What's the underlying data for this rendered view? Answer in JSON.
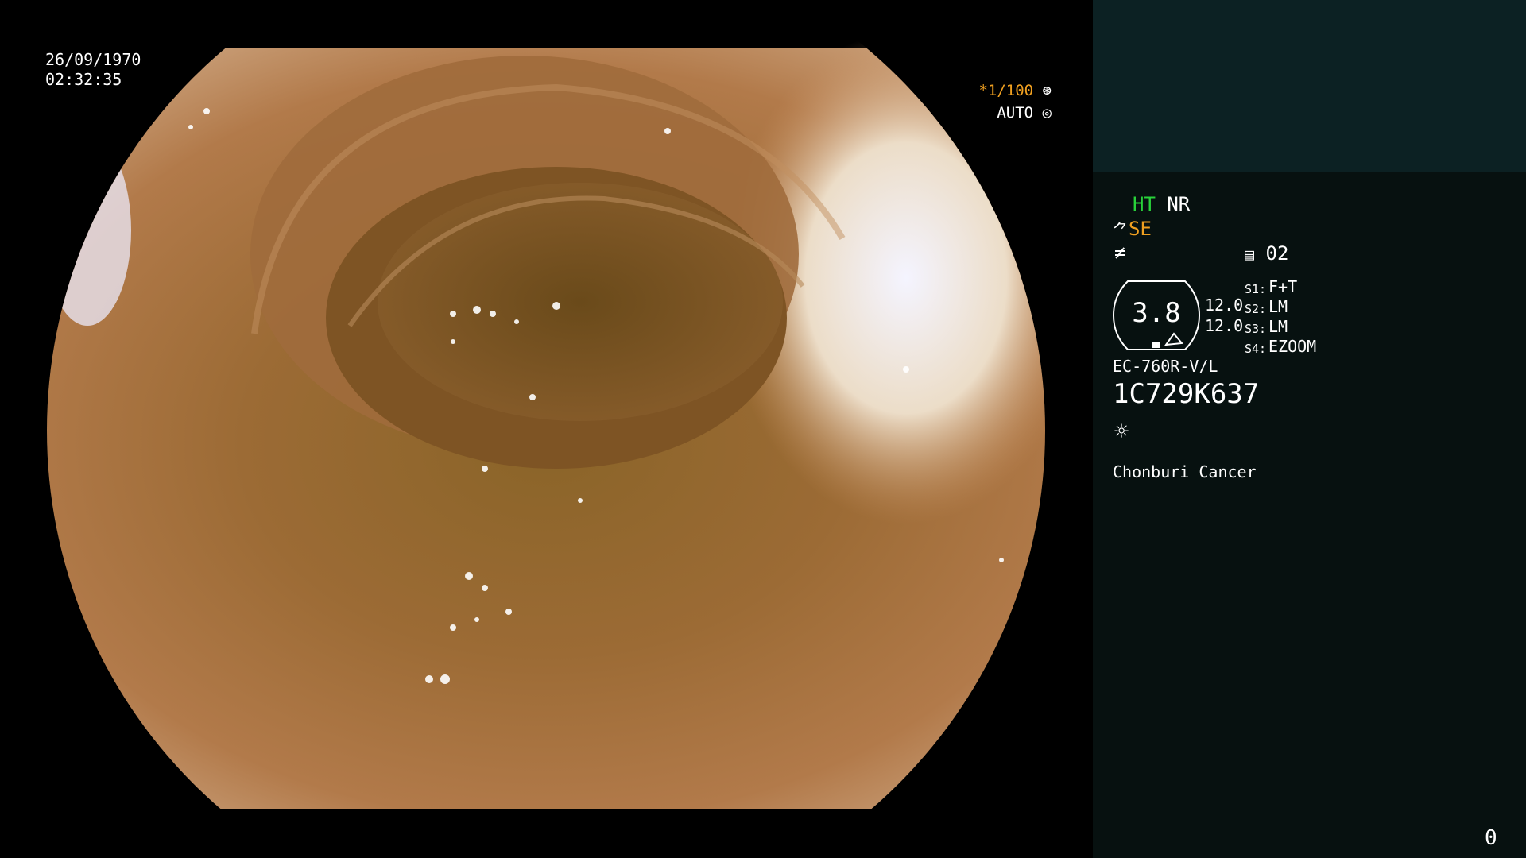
{
  "video": {
    "date": "26/09/1970",
    "time": "02:32:35",
    "shutter": "*1/100",
    "shutter_icon": "aperture-icon",
    "mode": "AUTO",
    "mode_icon": "iris-icon"
  },
  "panel": {
    "ht": "HT",
    "nr": "NR",
    "se": "SE",
    "memo_value": "02",
    "gauge_value": "3.8",
    "gauge_num_1": "12.0",
    "gauge_num_2": "12.0",
    "switches": [
      {
        "label": "S1:",
        "value": "F+T"
      },
      {
        "label": "S2:",
        "value": "LM"
      },
      {
        "label": "S3:",
        "value": "LM"
      },
      {
        "label": "S4:",
        "value": "EZOOM"
      }
    ],
    "model": "EC-760R-V/L",
    "serial": "1C729K637",
    "hospital": "Chonburi Cancer",
    "counter": "0"
  },
  "colors": {
    "ht": "#28d23a",
    "se": "#f0a020",
    "panel_top": "#0c2123",
    "panel": "#071110"
  }
}
